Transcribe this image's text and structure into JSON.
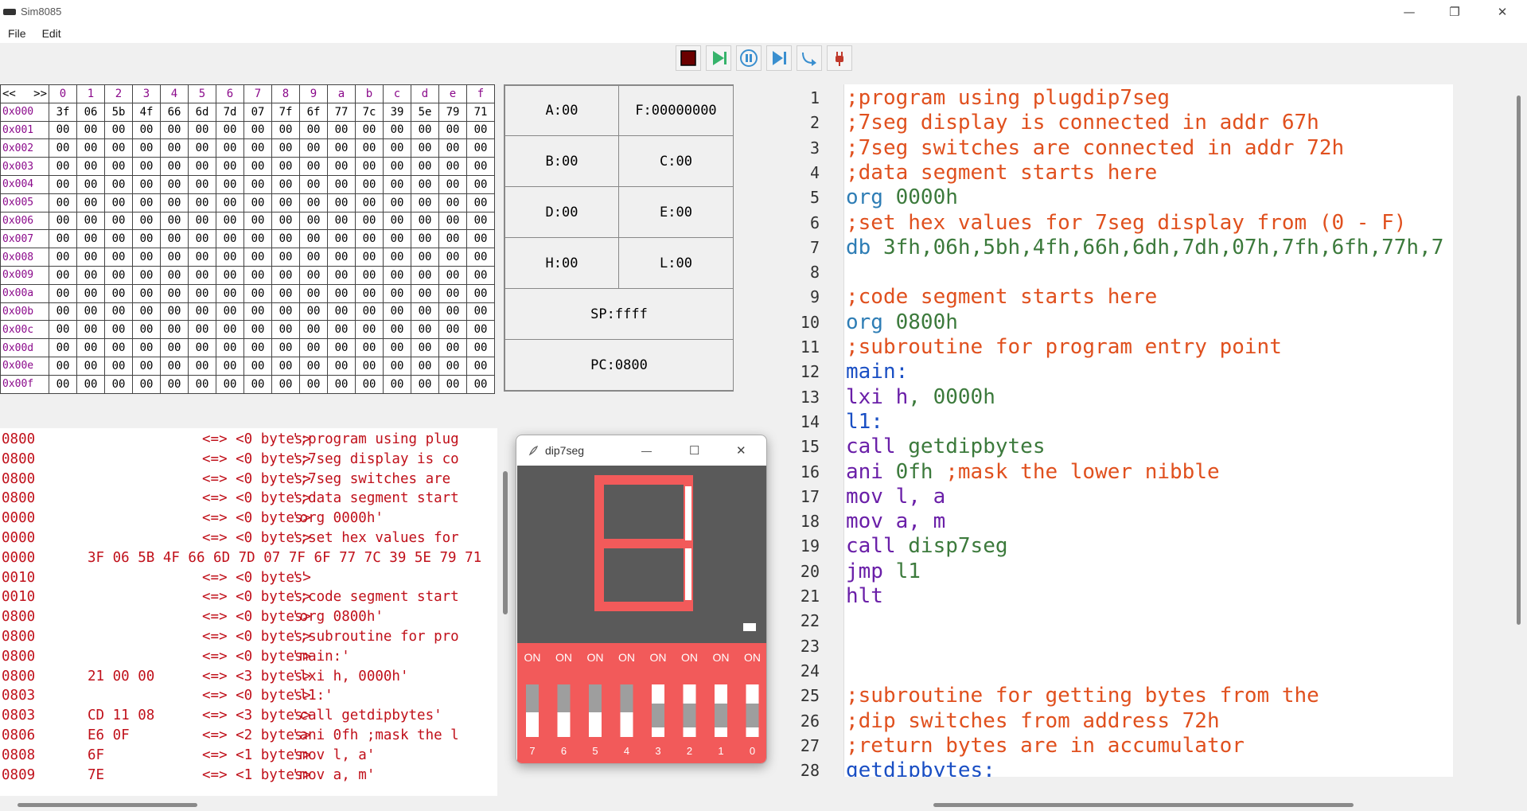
{
  "window": {
    "title": "Sim8085",
    "minimize": "—",
    "maximize": "❐",
    "close": "✕"
  },
  "menu": [
    "File",
    "Edit"
  ],
  "toolbar": [
    {
      "name": "stop-button",
      "icon": "stop-icon",
      "color": "#6b0000"
    },
    {
      "name": "run-button",
      "icon": "play-icon",
      "color": "#36b36b"
    },
    {
      "name": "pause-button",
      "icon": "pause-icon",
      "color": "#3a8fcf"
    },
    {
      "name": "step-button",
      "icon": "step-icon",
      "color": "#3a8fcf"
    },
    {
      "name": "step-over-button",
      "icon": "step-over-icon",
      "color": "#3a8fcf"
    },
    {
      "name": "plugin-button",
      "icon": "plug-icon",
      "color": "#c0392b"
    }
  ],
  "memory": {
    "prev": "<<",
    "next": ">>",
    "columns": [
      "0",
      "1",
      "2",
      "3",
      "4",
      "5",
      "6",
      "7",
      "8",
      "9",
      "a",
      "b",
      "c",
      "d",
      "e",
      "f"
    ],
    "rows": [
      {
        "addr": "0x000",
        "cells": [
          "3f",
          "06",
          "5b",
          "4f",
          "66",
          "6d",
          "7d",
          "07",
          "7f",
          "6f",
          "77",
          "7c",
          "39",
          "5e",
          "79",
          "71"
        ]
      },
      {
        "addr": "0x001",
        "cells": [
          "00",
          "00",
          "00",
          "00",
          "00",
          "00",
          "00",
          "00",
          "00",
          "00",
          "00",
          "00",
          "00",
          "00",
          "00",
          "00"
        ]
      },
      {
        "addr": "0x002",
        "cells": [
          "00",
          "00",
          "00",
          "00",
          "00",
          "00",
          "00",
          "00",
          "00",
          "00",
          "00",
          "00",
          "00",
          "00",
          "00",
          "00"
        ]
      },
      {
        "addr": "0x003",
        "cells": [
          "00",
          "00",
          "00",
          "00",
          "00",
          "00",
          "00",
          "00",
          "00",
          "00",
          "00",
          "00",
          "00",
          "00",
          "00",
          "00"
        ]
      },
      {
        "addr": "0x004",
        "cells": [
          "00",
          "00",
          "00",
          "00",
          "00",
          "00",
          "00",
          "00",
          "00",
          "00",
          "00",
          "00",
          "00",
          "00",
          "00",
          "00"
        ]
      },
      {
        "addr": "0x005",
        "cells": [
          "00",
          "00",
          "00",
          "00",
          "00",
          "00",
          "00",
          "00",
          "00",
          "00",
          "00",
          "00",
          "00",
          "00",
          "00",
          "00"
        ]
      },
      {
        "addr": "0x006",
        "cells": [
          "00",
          "00",
          "00",
          "00",
          "00",
          "00",
          "00",
          "00",
          "00",
          "00",
          "00",
          "00",
          "00",
          "00",
          "00",
          "00"
        ]
      },
      {
        "addr": "0x007",
        "cells": [
          "00",
          "00",
          "00",
          "00",
          "00",
          "00",
          "00",
          "00",
          "00",
          "00",
          "00",
          "00",
          "00",
          "00",
          "00",
          "00"
        ]
      },
      {
        "addr": "0x008",
        "cells": [
          "00",
          "00",
          "00",
          "00",
          "00",
          "00",
          "00",
          "00",
          "00",
          "00",
          "00",
          "00",
          "00",
          "00",
          "00",
          "00"
        ]
      },
      {
        "addr": "0x009",
        "cells": [
          "00",
          "00",
          "00",
          "00",
          "00",
          "00",
          "00",
          "00",
          "00",
          "00",
          "00",
          "00",
          "00",
          "00",
          "00",
          "00"
        ]
      },
      {
        "addr": "0x00a",
        "cells": [
          "00",
          "00",
          "00",
          "00",
          "00",
          "00",
          "00",
          "00",
          "00",
          "00",
          "00",
          "00",
          "00",
          "00",
          "00",
          "00"
        ]
      },
      {
        "addr": "0x00b",
        "cells": [
          "00",
          "00",
          "00",
          "00",
          "00",
          "00",
          "00",
          "00",
          "00",
          "00",
          "00",
          "00",
          "00",
          "00",
          "00",
          "00"
        ]
      },
      {
        "addr": "0x00c",
        "cells": [
          "00",
          "00",
          "00",
          "00",
          "00",
          "00",
          "00",
          "00",
          "00",
          "00",
          "00",
          "00",
          "00",
          "00",
          "00",
          "00"
        ]
      },
      {
        "addr": "0x00d",
        "cells": [
          "00",
          "00",
          "00",
          "00",
          "00",
          "00",
          "00",
          "00",
          "00",
          "00",
          "00",
          "00",
          "00",
          "00",
          "00",
          "00"
        ]
      },
      {
        "addr": "0x00e",
        "cells": [
          "00",
          "00",
          "00",
          "00",
          "00",
          "00",
          "00",
          "00",
          "00",
          "00",
          "00",
          "00",
          "00",
          "00",
          "00",
          "00"
        ]
      },
      {
        "addr": "0x00f",
        "cells": [
          "00",
          "00",
          "00",
          "00",
          "00",
          "00",
          "00",
          "00",
          "00",
          "00",
          "00",
          "00",
          "00",
          "00",
          "00",
          "00"
        ]
      }
    ]
  },
  "registers": {
    "A": "A:00",
    "F": "F:00000000",
    "B": "B:00",
    "C": "C:00",
    "D": "D:00",
    "E": "E:00",
    "H": "H:00",
    "L": "L:00",
    "SP": "SP:ffff",
    "PC": "PC:0800"
  },
  "listing": [
    {
      "addr": "0800",
      "bytes": "",
      "arrow": "<=> <0 bytes>",
      "src": "';program using plug"
    },
    {
      "addr": "0800",
      "bytes": "",
      "arrow": "<=> <0 bytes>",
      "src": "';7seg display is co"
    },
    {
      "addr": "0800",
      "bytes": "",
      "arrow": "<=> <0 bytes>",
      "src": "';7seg switches are "
    },
    {
      "addr": "0800",
      "bytes": "",
      "arrow": "<=> <0 bytes>",
      "src": "';data segment start"
    },
    {
      "addr": "0000",
      "bytes": "",
      "arrow": "<=> <0 bytes>",
      "src": "'org 0000h'"
    },
    {
      "addr": "0000",
      "bytes": "",
      "arrow": "<=> <0 bytes>",
      "src": "';set hex values for"
    },
    {
      "addr": "0000",
      "bytes": "3F 06 5B 4F 66 6D 7D 07 7F 6F 77 7C 39 5E 79 71",
      "arrow": "",
      "src": ""
    },
    {
      "addr": "0010",
      "bytes": "",
      "arrow": "<=> <0 bytes>",
      "src": "''"
    },
    {
      "addr": "0010",
      "bytes": "",
      "arrow": "<=> <0 bytes>",
      "src": "';code segment start"
    },
    {
      "addr": "0800",
      "bytes": "",
      "arrow": "<=> <0 bytes>",
      "src": "'org 0800h'"
    },
    {
      "addr": "0800",
      "bytes": "",
      "arrow": "<=> <0 bytes>",
      "src": "';subroutine for pro"
    },
    {
      "addr": "0800",
      "bytes": "",
      "arrow": "<=> <0 bytes>",
      "src": "'main:'"
    },
    {
      "addr": "0800",
      "bytes": "21 00 00",
      "arrow": "<=> <3 bytes>",
      "src": "'lxi h, 0000h'"
    },
    {
      "addr": "0803",
      "bytes": "",
      "arrow": "<=> <0 bytes>",
      "src": "'l1:'"
    },
    {
      "addr": "0803",
      "bytes": "CD 11 08",
      "arrow": "<=> <3 bytes>",
      "src": "'call getdipbytes'"
    },
    {
      "addr": "0806",
      "bytes": "E6 0F",
      "arrow": "<=> <2 bytes>",
      "src": "'ani 0fh ;mask the l"
    },
    {
      "addr": "0808",
      "bytes": "6F",
      "arrow": "<=> <1 bytes>",
      "src": "'mov l, a'"
    },
    {
      "addr": "0809",
      "bytes": "7E",
      "arrow": "<=> <1 bytes>",
      "src": "'mov a, m'"
    }
  ],
  "dip7seg": {
    "title": "dip7seg",
    "minimize": "—",
    "maximize": "☐",
    "close": "✕",
    "segments_on": [
      "a",
      "b",
      "c",
      "d",
      "e",
      "f",
      "g"
    ],
    "dp_on": true,
    "segment_on_color": "#f25a5a",
    "segment_off_color": "#ffffff",
    "switch_label": "ON",
    "switches": [
      {
        "num": "7",
        "on": false
      },
      {
        "num": "6",
        "on": false
      },
      {
        "num": "5",
        "on": false
      },
      {
        "num": "4",
        "on": false
      },
      {
        "num": "3",
        "on": true
      },
      {
        "num": "2",
        "on": true
      },
      {
        "num": "1",
        "on": true
      },
      {
        "num": "0",
        "on": true
      }
    ]
  },
  "editor": {
    "line_numbers": [
      "1",
      "2",
      "3",
      "4",
      "5",
      "6",
      "7",
      "8",
      "9",
      "10",
      "11",
      "12",
      "13",
      "14",
      "15",
      "16",
      "17",
      "18",
      "19",
      "20",
      "21",
      "22",
      "23",
      "24",
      "25",
      "26",
      "27",
      "28"
    ],
    "lines": [
      [
        {
          "t": ";program using plugdip7seg",
          "c": "comment"
        }
      ],
      [
        {
          "t": ";7seg display is connected in addr 67h",
          "c": "comment"
        }
      ],
      [
        {
          "t": ";7seg switches are connected in addr 72h",
          "c": "comment"
        }
      ],
      [
        {
          "t": ";data segment starts here",
          "c": "comment"
        }
      ],
      [
        {
          "t": "org ",
          "c": "dir"
        },
        {
          "t": "0000h",
          "c": "num"
        }
      ],
      [
        {
          "t": ";set hex values for 7seg display from (0 - F)",
          "c": "comment"
        }
      ],
      [
        {
          "t": "db ",
          "c": "dir"
        },
        {
          "t": "3fh,06h,5bh,4fh,66h,6dh,7dh,07h,7fh,6fh,77h,7",
          "c": "num"
        }
      ],
      [],
      [
        {
          "t": ";code segment starts here",
          "c": "comment"
        }
      ],
      [
        {
          "t": "org ",
          "c": "dir"
        },
        {
          "t": "0800h",
          "c": "num"
        }
      ],
      [
        {
          "t": ";subroutine for program entry point",
          "c": "comment"
        }
      ],
      [
        {
          "t": "main:",
          "c": "label"
        }
      ],
      [
        {
          "t": "lxi ",
          "c": "instr"
        },
        {
          "t": "h",
          "c": "instr"
        },
        {
          "t": ", 0000h",
          "c": "num"
        }
      ],
      [
        {
          "t": "l1:",
          "c": "label"
        }
      ],
      [
        {
          "t": "call ",
          "c": "instr"
        },
        {
          "t": "getdipbytes",
          "c": "arg"
        }
      ],
      [
        {
          "t": "ani ",
          "c": "instr"
        },
        {
          "t": "0fh ",
          "c": "num"
        },
        {
          "t": ";mask the lower nibble",
          "c": "comment"
        }
      ],
      [
        {
          "t": "mov ",
          "c": "instr"
        },
        {
          "t": "l, a",
          "c": "instr"
        }
      ],
      [
        {
          "t": "mov ",
          "c": "instr"
        },
        {
          "t": "a, m",
          "c": "instr"
        }
      ],
      [
        {
          "t": "call ",
          "c": "instr"
        },
        {
          "t": "disp7seg",
          "c": "arg"
        }
      ],
      [
        {
          "t": "jmp ",
          "c": "instr"
        },
        {
          "t": "l1",
          "c": "arg"
        }
      ],
      [
        {
          "t": "hlt",
          "c": "instr"
        }
      ],
      [],
      [],
      [],
      [
        {
          "t": ";subroutine for getting bytes from the",
          "c": "comment"
        }
      ],
      [
        {
          "t": ";dip switches from address 72h",
          "c": "comment"
        }
      ],
      [
        {
          "t": ";return bytes are in accumulator",
          "c": "comment"
        }
      ],
      [
        {
          "t": "getdipbytes:",
          "c": "label"
        }
      ]
    ]
  }
}
